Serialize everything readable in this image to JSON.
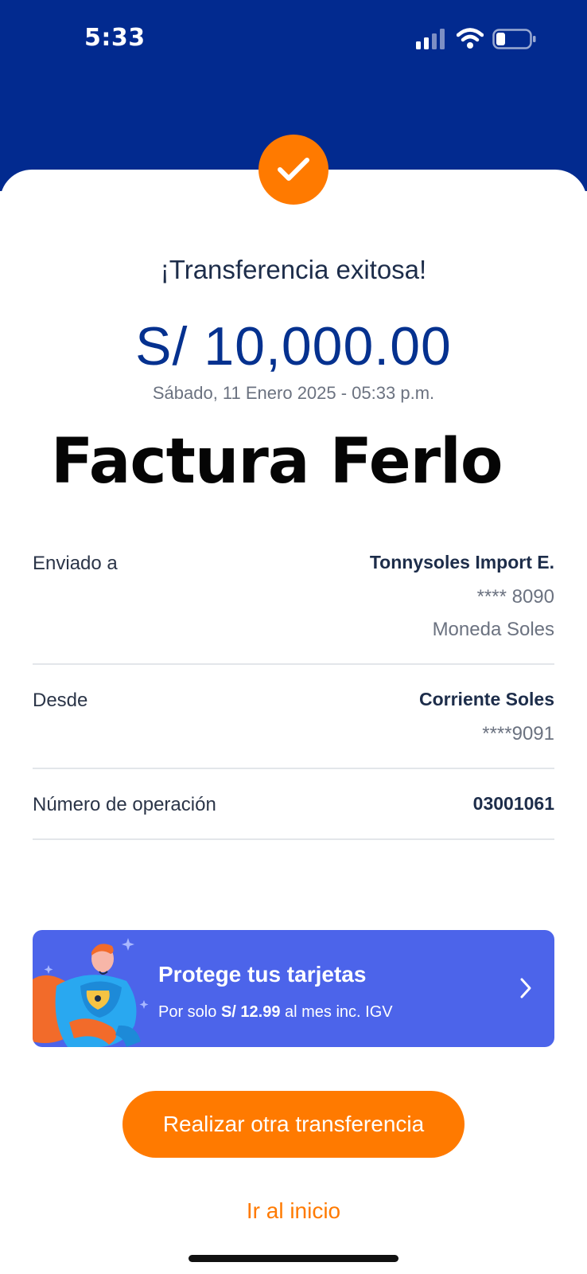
{
  "status_bar": {
    "time": "5:33"
  },
  "receipt": {
    "title": "¡Transferencia exitosa!",
    "amount": "S/ 10,000.00",
    "datetime": "Sábado, 11 Enero 2025 - 05:33 p.m.",
    "overlay_text": "Factura Ferlo"
  },
  "details": {
    "sent_to": {
      "label": "Enviado a",
      "name": "Tonnysoles Import E.",
      "account": "**** 8090",
      "currency": "Moneda Soles"
    },
    "from": {
      "label": "Desde",
      "name": "Corriente Soles",
      "account": "****9091"
    },
    "operation": {
      "label": "Número de operación",
      "value": "03001061"
    }
  },
  "promo": {
    "title": "Protege tus tarjetas",
    "sub_prefix": "Por solo ",
    "sub_price": "S/ 12.99",
    "sub_suffix": " al mes inc. IGV"
  },
  "actions": {
    "primary": "Realizar otra transferencia",
    "secondary": "Ir al inicio"
  },
  "colors": {
    "header": "#022a8f",
    "accent": "#ff7a00",
    "promo": "#4c64ea",
    "amount": "#05318f"
  }
}
